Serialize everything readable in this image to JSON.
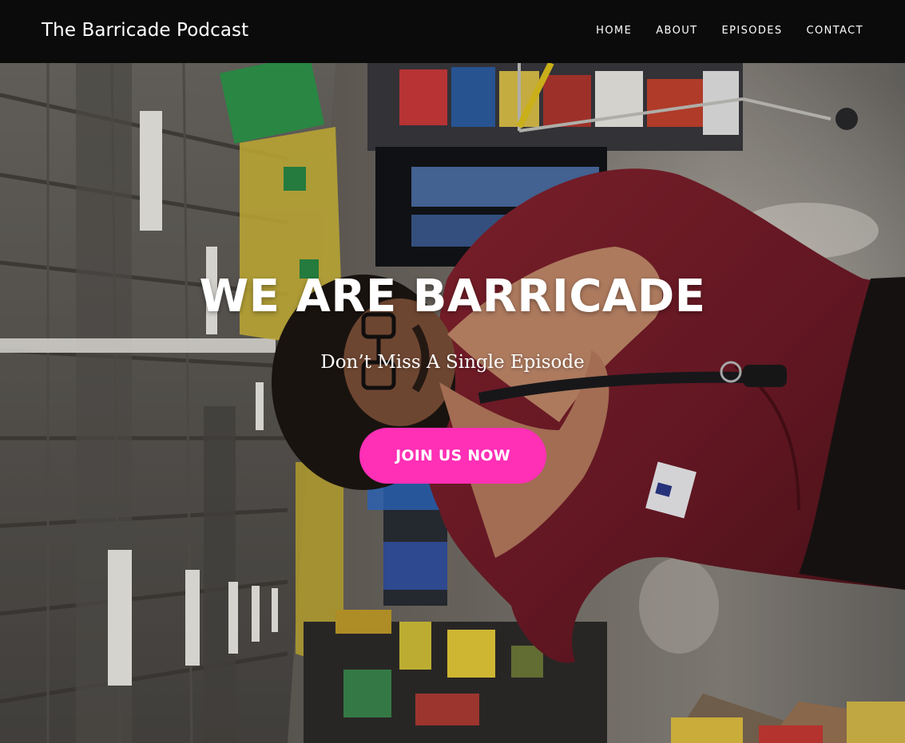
{
  "header": {
    "site_title": "The Barricade Podcast",
    "background": "#0b0b0c",
    "nav": [
      {
        "label": "HOME"
      },
      {
        "label": "ABOUT"
      },
      {
        "label": "EPISODES"
      },
      {
        "label": "CONTACT"
      }
    ]
  },
  "hero": {
    "title": "WE ARE BARRICADE",
    "subtitle": "Don’t Miss A Single Episode",
    "cta_label": "JOIN US NOW",
    "cta_color": "#ff2fb6"
  }
}
